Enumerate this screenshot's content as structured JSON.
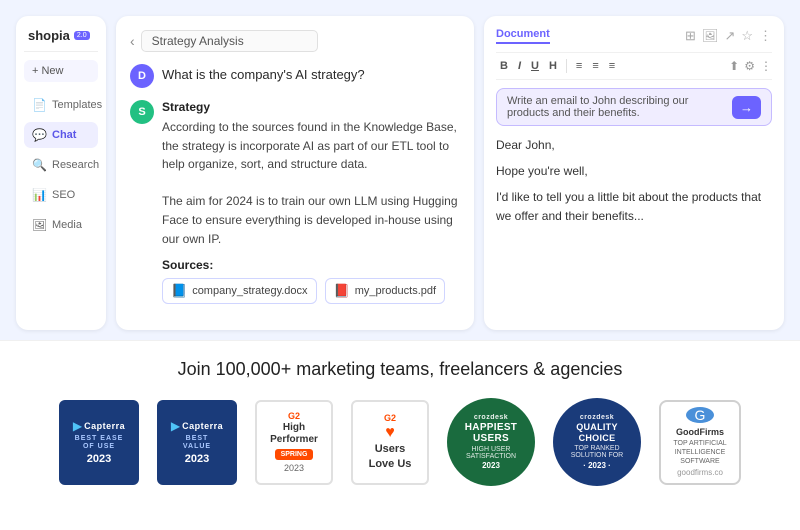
{
  "app": {
    "logo_text": "shopia",
    "logo_badge": "2.0",
    "new_btn_label": "+ New"
  },
  "sidebar": {
    "items": [
      {
        "label": "Templates",
        "icon": "📄"
      },
      {
        "label": "Chat",
        "icon": "💬"
      },
      {
        "label": "Research",
        "icon": "🔍"
      },
      {
        "label": "SEO",
        "icon": "📊"
      },
      {
        "label": "Media",
        "icon": "🖼"
      }
    ],
    "active_index": 1
  },
  "breadcrumb": {
    "text": "Strategy Analysis"
  },
  "chat": {
    "question": "What is the company's AI strategy?",
    "answer_title": "Strategy",
    "answer_body": "According to the sources found in the Knowledge Base, the strategy is incorporate AI as part of our ETL tool to help organize, sort, and structure data.\n\nThe aim for 2024 is to train our own LLM using Hugging Face to ensure everything is developed in-house using our own IP.",
    "sources_label": "Sources:",
    "sources": [
      {
        "name": "company_strategy.docx",
        "type": "word"
      },
      {
        "name": "my_products.pdf",
        "type": "pdf"
      }
    ]
  },
  "document": {
    "tab_label": "Document",
    "toolbar_buttons": [
      "B",
      "I",
      "U",
      "H",
      "≡",
      "≡",
      "≡"
    ],
    "ai_prompt": "Write an email to John describing our products and their benefits.",
    "ai_send_label": "→",
    "body_lines": [
      "Dear John,",
      "",
      "Hope you're well,",
      "",
      "I'd like to tell you a little bit about the products that we offer and their benefits..."
    ]
  },
  "marketing": {
    "headline": "Join 100,000+ marketing teams, freelancers & agencies",
    "badges": [
      {
        "id": "capterra-ease",
        "type": "capterra",
        "line1": "BEST EASE OF USE",
        "year": "2023"
      },
      {
        "id": "capterra-value",
        "type": "capterra",
        "line1": "BEST VALUE",
        "year": "2023"
      },
      {
        "id": "g2-highperformer",
        "type": "g2-hp",
        "line1": "High",
        "line2": "Performer",
        "season": "SPRING",
        "year": "2023"
      },
      {
        "id": "g2-userslove",
        "type": "g2-love",
        "line1": "Users",
        "line2": "Love Us"
      },
      {
        "id": "crozdesk-happiest",
        "type": "crozdesk-happy",
        "logo": "crozdesk",
        "title": "HAPPIEST USERS",
        "sub": "HIGH USER SATISFACTION",
        "year": "2023"
      },
      {
        "id": "crozdesk-quality",
        "type": "crozdesk-quality",
        "logo": "crozdesk",
        "title": "QUALITY CHOICE",
        "sub": "TOP RANKED SOLUTION FOR",
        "year": "2023"
      },
      {
        "id": "goodfirms",
        "type": "goodfirms",
        "name": "GoodFirms",
        "sub": "TOP ARTIFICIAL\nINTELLIGENCE SOFTWARE",
        "url": "goodfirms.co"
      }
    ]
  }
}
